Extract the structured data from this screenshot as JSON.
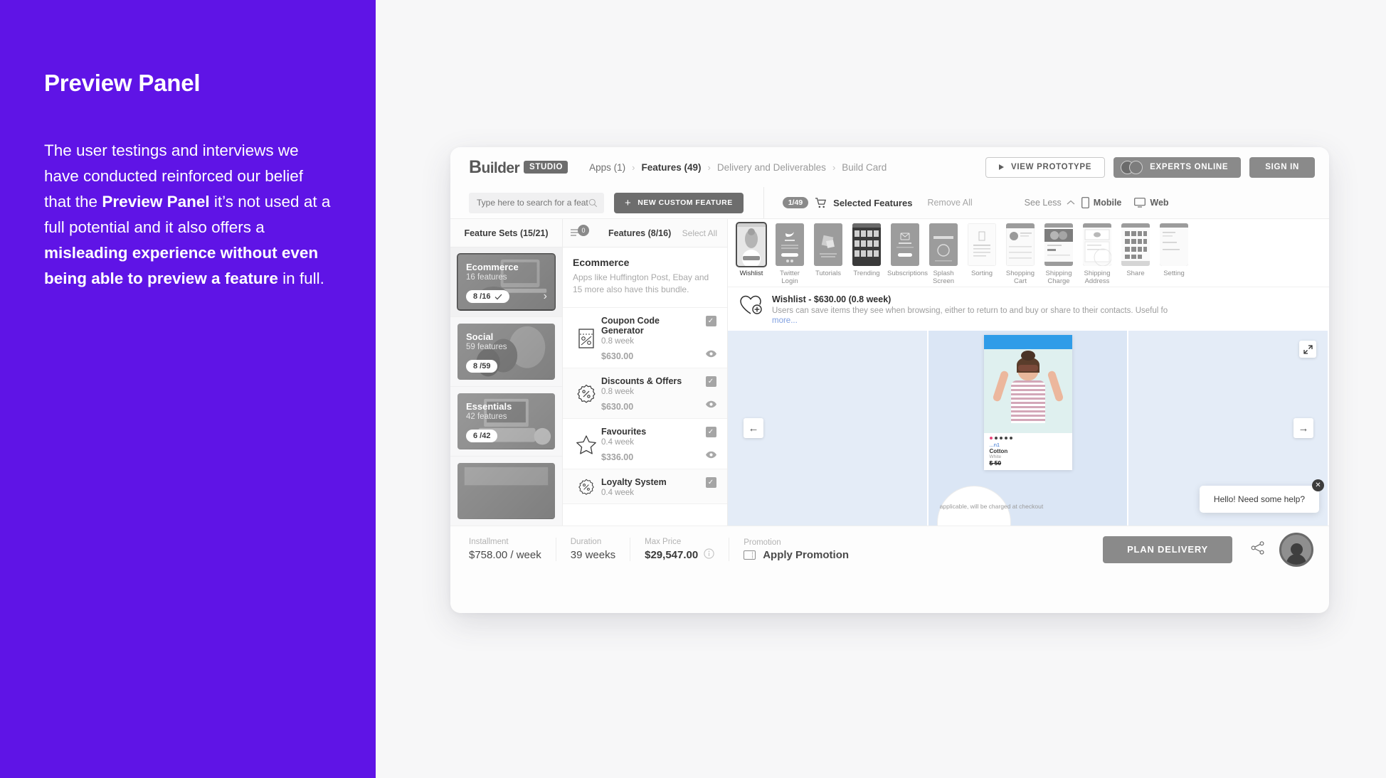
{
  "left": {
    "title": "Preview Panel",
    "body_parts": [
      {
        "t": "The user testings and interviews we have conducted reinforced our belief that the ",
        "b": false
      },
      {
        "t": "Preview Panel",
        "b": true
      },
      {
        "t": " it’s not used at a full potential and it also offers a ",
        "b": false
      },
      {
        "t": "misleading experience without even being able to preview a feature",
        "b": true
      },
      {
        "t": " in full.",
        "b": false
      }
    ]
  },
  "app": {
    "logo": {
      "word_b": "B",
      "word_rest": "uilder",
      "badge": "STUDIO"
    },
    "breadcrumbs": [
      {
        "label": "Apps (1)",
        "state": "semi"
      },
      {
        "label": "Features (49)",
        "state": "active"
      },
      {
        "label": "Delivery and Deliverables",
        "state": "muted"
      },
      {
        "label": "Build Card",
        "state": "muted"
      }
    ],
    "crumb_sep": "›",
    "view_prototype": "VIEW PROTOTYPE",
    "experts_online": "EXPERTS ONLINE",
    "sign_in": "SIGN IN",
    "search": {
      "placeholder": "Type here to search for a feature",
      "value": ""
    },
    "new_custom_feature": "NEW CUSTOM FEATURE",
    "selected": {
      "pill": "1/49",
      "label": "Selected Features",
      "remove_all": "Remove All"
    },
    "see_less": "See Less",
    "views": [
      {
        "label": "Mobile",
        "icon": "mobile-icon"
      },
      {
        "label": "Web",
        "icon": "monitor-icon"
      }
    ],
    "feature_sets": {
      "header": "Feature Sets (15/21)",
      "items": [
        {
          "name": "Ecommerce",
          "count": "16 features",
          "pill": "8 /16",
          "selected": true,
          "checked": true
        },
        {
          "name": "Social",
          "count": "59 features",
          "pill": "8 /59",
          "selected": false,
          "checked": false
        },
        {
          "name": "Essentials",
          "count": "42 features",
          "pill": "6 /42",
          "selected": false,
          "checked": false
        }
      ]
    },
    "features": {
      "filter_badge": "0",
      "header": "Features (8/16)",
      "select_all": "Select All",
      "bundle": {
        "title": "Ecommerce",
        "desc": "Apps like Huffington Post, Ebay and 15 more also have this bundle."
      },
      "items": [
        {
          "name": "Coupon Code Generator",
          "duration": "0.8 week",
          "price": "$630.00",
          "icon": "coupon-icon",
          "checked": true
        },
        {
          "name": "Discounts & Offers",
          "duration": "0.8 week",
          "price": "$630.00",
          "icon": "percent-badge-icon",
          "checked": true
        },
        {
          "name": "Favourites",
          "duration": "0.4 week",
          "price": "$336.00",
          "icon": "star-icon",
          "checked": true
        },
        {
          "name": "Loyalty System",
          "duration": "0.4 week",
          "price": "",
          "icon": "percent-badge-icon",
          "checked": true
        }
      ]
    },
    "preview": {
      "thumbs": [
        {
          "label": "Wishlist",
          "active": true
        },
        {
          "label": "Twitter Login",
          "active": false
        },
        {
          "label": "Tutorials",
          "active": false
        },
        {
          "label": "Trending",
          "active": false
        },
        {
          "label": "Subscriptions",
          "active": false
        },
        {
          "label": "Splash Screen",
          "active": false
        },
        {
          "label": "Sorting",
          "active": false
        },
        {
          "label": "Shopping Cart",
          "active": false
        },
        {
          "label": "Shipping Charge",
          "active": false
        },
        {
          "label": "Shipping Address",
          "active": false
        },
        {
          "label": "Share",
          "active": false
        },
        {
          "label": "Setting",
          "active": false
        }
      ],
      "detail": {
        "title": "Wishlist - $630.00 (0.8 week)",
        "desc": "Users can save items they see when browsing, either to return to and buy or share to their contacts. Useful fo",
        "more": "more..."
      },
      "phone": {
        "title_line": "...n1",
        "l2": "Cotton",
        "l3": "White",
        "l4": "$ 50",
        "ship_note": "applicable, will be charged at checkout"
      },
      "nav_prev": "←",
      "nav_next": "→",
      "chat": "Hello! Need some help?"
    },
    "footer": {
      "installment": {
        "key": "Installment",
        "value": "$758.00 / week"
      },
      "duration": {
        "key": "Duration",
        "value": "39 weeks"
      },
      "max_price": {
        "key": "Max Price",
        "value": "$29,547.00"
      },
      "promotion": {
        "key": "Promotion",
        "value": "Apply Promotion"
      },
      "plan_delivery": "PLAN DELIVERY"
    }
  },
  "colors": {
    "brand_purple": "#5f14e6",
    "gray_btn": "#8a8a8a",
    "dark_btn": "#6d6d6d",
    "link_blue": "#7f9fe0"
  }
}
